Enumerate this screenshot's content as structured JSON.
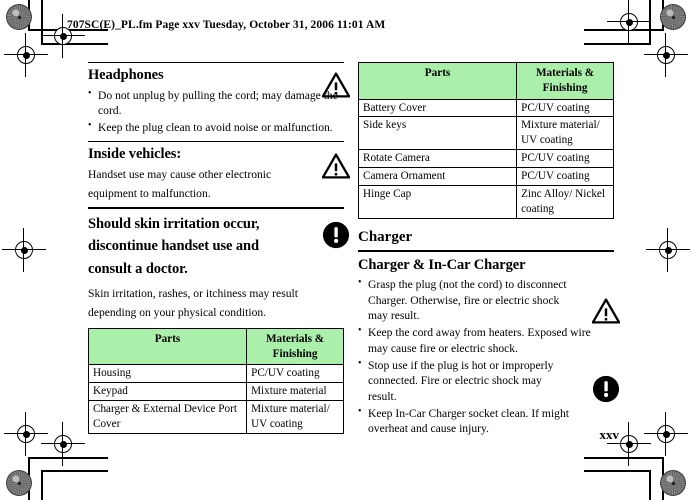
{
  "running_head": "707SC(E)_PL.fm  Page xxv  Tuesday, October 31, 2006  11:01 AM",
  "folio": "xxv",
  "colors": {
    "table_header_green": "#aaf0aa",
    "text": "#000000",
    "rule": "#000000"
  },
  "left_column": {
    "headphones": {
      "heading": "Headphones",
      "icon": "warning-triangle-icon",
      "bullets": [
        "Do not unplug by pulling the cord; may damage the cord.",
        "Keep the plug clean to avoid noise or malfunction."
      ]
    },
    "inside_vehicles": {
      "heading": "Inside vehicles:",
      "icon": "warning-triangle-icon",
      "body": "Handset use may cause other electronic equipment to malfunction."
    },
    "skin_irritation": {
      "heading": "Should skin irritation occur, discontinue handset use and consult a doctor.",
      "icon": "exclamation-circle-icon",
      "body": "Skin irritation, rashes, or itchiness may result depending on your physical condition."
    },
    "parts_table": {
      "headers": [
        "Parts",
        "Materials & Finishing"
      ],
      "rows": [
        [
          "Housing",
          "PC/UV coating"
        ],
        [
          "Keypad",
          "Mixture material"
        ],
        [
          "Charger & External Device Port Cover",
          "Mixture material/ UV coating"
        ]
      ]
    }
  },
  "right_column": {
    "parts_table": {
      "headers": [
        "Parts",
        "Materials & Finishing"
      ],
      "rows": [
        [
          "Battery Cover",
          "PC/UV coating"
        ],
        [
          "Side keys",
          "Mixture material/ UV coating"
        ],
        [
          "Rotate Camera",
          "PC/UV coating"
        ],
        [
          "Camera Ornament",
          "PC/UV coating"
        ],
        [
          "Hinge Cap",
          "Zinc Alloy/ Nickel coating"
        ]
      ]
    },
    "charger": {
      "chapter_heading": "Charger",
      "sub_heading": "Charger & In-Car Charger",
      "icons": [
        "warning-triangle-icon",
        "exclamation-circle-icon"
      ],
      "bullets": [
        "Grasp the plug (not the cord) to disconnect Charger. Otherwise, fire or electric shock may result.",
        "Keep the cord away from heaters. Exposed wire may cause fire or electric shock.",
        "Stop use if the plug is hot or improperly connected. Fire or electric shock may result.",
        "Keep In-Car Charger socket clean. If might overheat and cause injury."
      ]
    }
  }
}
